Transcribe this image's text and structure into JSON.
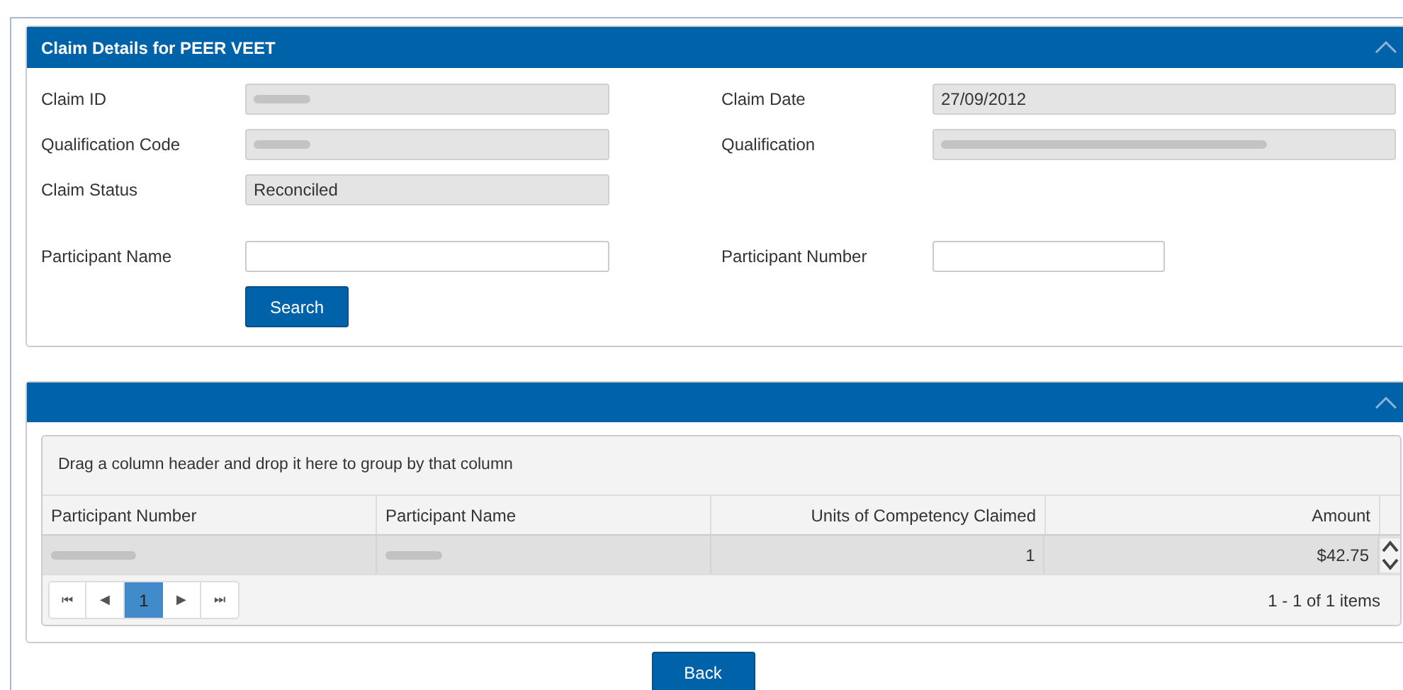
{
  "claim_panel": {
    "title": "Claim Details for PEER VEET",
    "collapsed": false,
    "fields": [
      {
        "label": "Claim ID",
        "redacted": true
      },
      {
        "label": "Claim Date",
        "value": "27/09/2012"
      },
      {
        "label": "Qualification Code",
        "redacted": true
      },
      {
        "label": "Qualification",
        "redacted": true
      },
      {
        "label": "Claim Status",
        "value": "Reconciled"
      }
    ],
    "search_fields": [
      {
        "label": "Participant Name",
        "kind": "wide"
      },
      {
        "label": "Participant Number",
        "kind": "narrow"
      }
    ],
    "search_button": "Search"
  },
  "results_panel": {
    "collapsed": false,
    "group_hint": "Drag a column header and drop it here to group by that column",
    "table": {
      "columns": [
        {
          "label": "Participant Number"
        },
        {
          "label": "Participant Name"
        },
        {
          "label": "Units of Competency Claimed"
        },
        {
          "label": "Amount"
        }
      ],
      "rows": [
        [
          {
            "redacted": true
          },
          {
            "redacted": true
          },
          {
            "value": "1"
          },
          {
            "value": "$42.75"
          }
        ]
      ]
    },
    "pager": {
      "first": "⏮",
      "prev": "◀",
      "pages": [
        {
          "label": "1",
          "selected": true
        }
      ],
      "next": "▶",
      "last": "⏭"
    },
    "item_count": "1 - 1 of 1 items"
  },
  "back_button": "Back"
}
